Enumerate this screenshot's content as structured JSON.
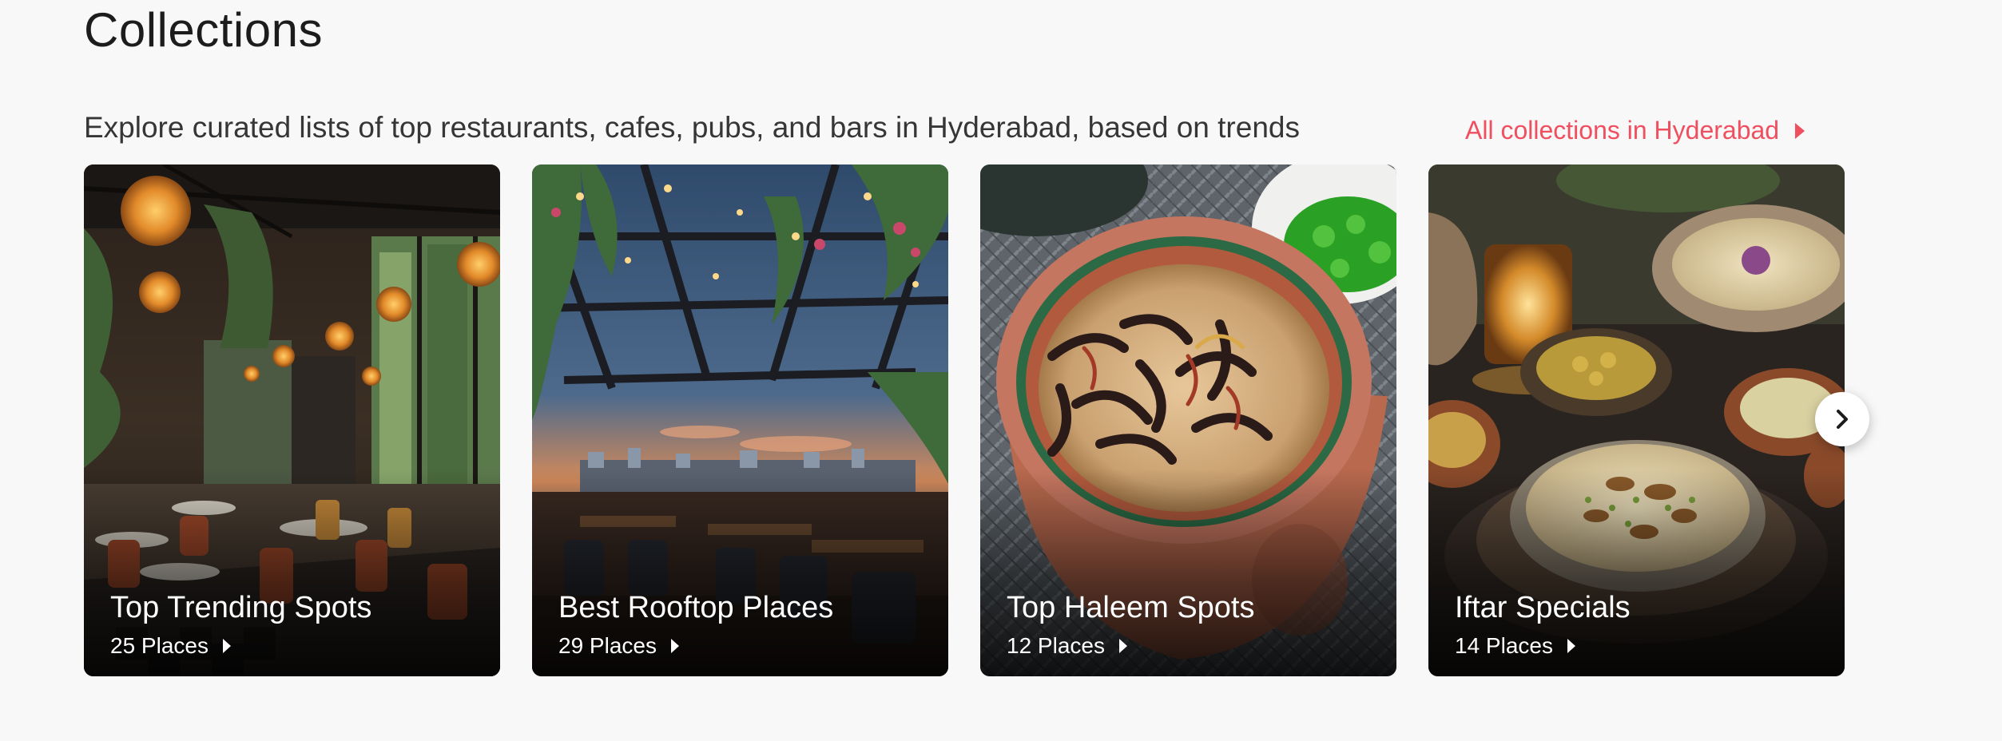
{
  "header": {
    "title": "Collections",
    "subtitle": "Explore curated lists of top restaurants, cafes, pubs, and bars in Hyderabad, based on trends",
    "all_link": "All collections in Hyderabad",
    "accent_color": "#ef4f5f"
  },
  "collections": [
    {
      "title": "Top Trending Spots",
      "places": "25 Places",
      "image": "restaurant-interior-with-lanterns-photo"
    },
    {
      "title": "Best Rooftop Places",
      "places": "29 Places",
      "image": "rooftop-restaurant-at-sunset-photo"
    },
    {
      "title": "Top Haleem Spots",
      "places": "12 Places",
      "image": "haleem-in-clay-pot-photo"
    },
    {
      "title": "Iftar Specials",
      "places": "14 Places",
      "image": "iftar-desserts-spread-photo"
    }
  ],
  "carousel": {
    "next_icon": "chevron-right-icon"
  }
}
